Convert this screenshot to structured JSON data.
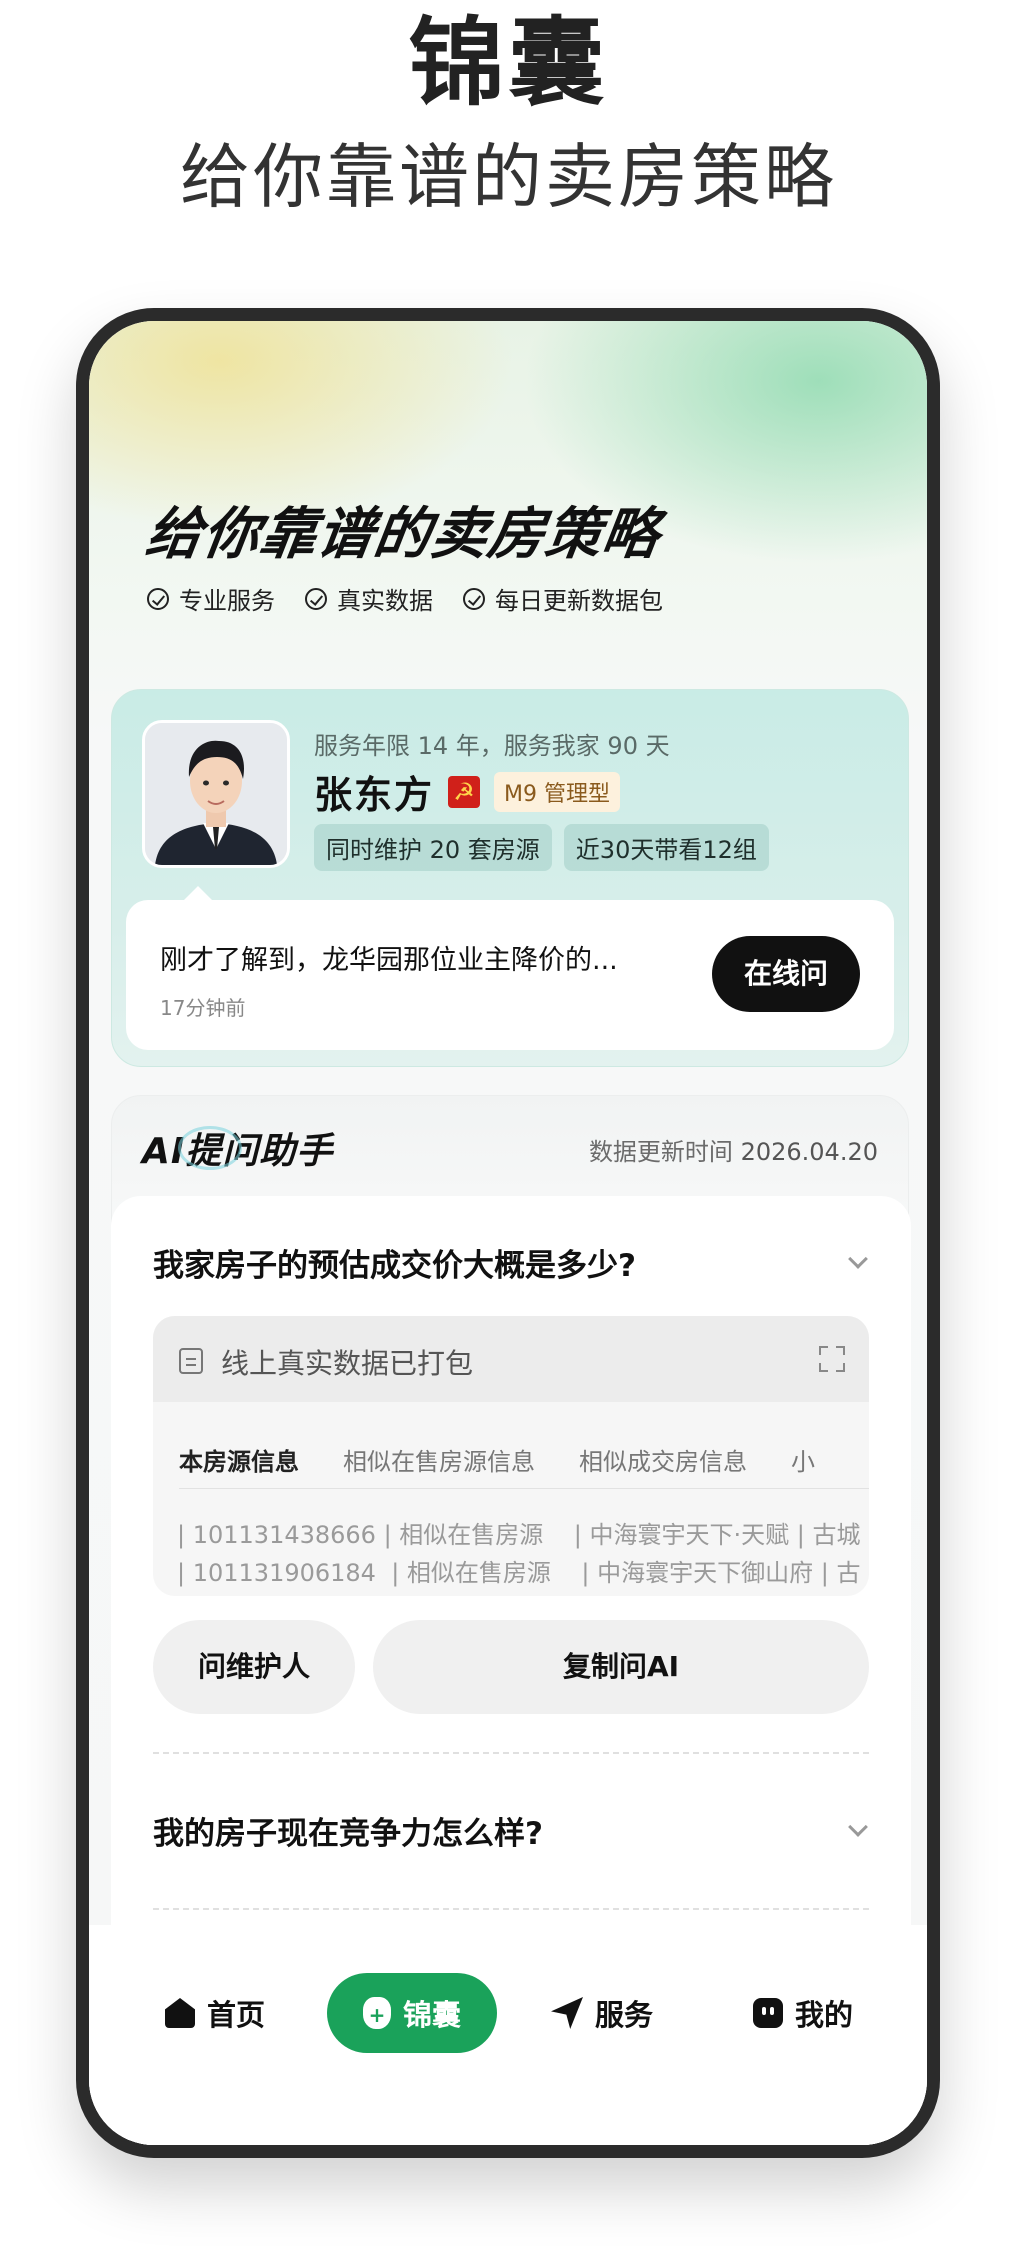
{
  "promo": {
    "title": "锦囊",
    "subtitle": "给你靠谱的卖房策略"
  },
  "hero": {
    "title": "给你靠谱的卖房策略",
    "tags": [
      "专业服务",
      "真实数据",
      "每日更新数据包"
    ]
  },
  "agent": {
    "meta": "服务年限 14 年，服务我家 90 天",
    "name": "张东方",
    "level": "M9 管理型",
    "stats": [
      "同时维护 20 套房源",
      "近30天带看12组"
    ],
    "message": "刚才了解到，龙华园那位业主降价的...",
    "message_time": "17分钟前",
    "online_button": "在线问"
  },
  "ai": {
    "title": "AI提问助手",
    "update_label": "数据更新时间",
    "update_date": "2026.04.20",
    "question1": "我家房子的预估成交价大概是多少?",
    "pack_label": "线上真实数据已打包",
    "tabs": [
      "本房源信息",
      "相似在售房源信息",
      "相似成交房信息",
      "小"
    ],
    "rows": [
      "| 101131438666 | 相似在售房源    | 中海寰宇天下·天赋 | 古城",
      "| 101131906184  | 相似在售房源    | 中海寰宇天下御山府 | 古"
    ],
    "ask_button": "问维护人",
    "copy_button": "复制问AI",
    "question2": "我的房子现在竞争力怎么样?"
  },
  "tabbar": {
    "home": "首页",
    "bag": "锦囊",
    "service": "服务",
    "mine": "我的"
  },
  "colors": {
    "accent_green": "#1aa25a",
    "dark_button": "#111111"
  }
}
